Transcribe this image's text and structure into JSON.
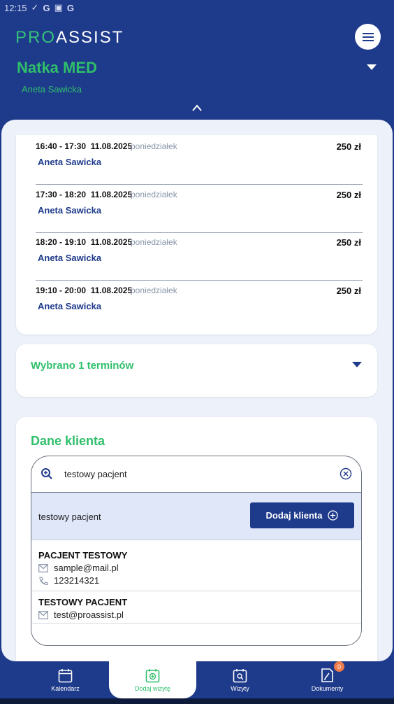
{
  "status_bar": {
    "time": "12:15",
    "icons": [
      "signal-icon",
      "google-icon",
      "photo-icon",
      "google-icon"
    ]
  },
  "header": {
    "logo_part1": "PRO",
    "logo_part2": "ASSIST",
    "clinic_name": "Natka MED",
    "doctor_name": "Aneta Sawicka"
  },
  "slots": [
    {
      "time": "16:40 - 17:30",
      "date": "11.08.2025",
      "day": "poniedziałek",
      "price": "250 zł",
      "person": "Aneta Sawicka"
    },
    {
      "time": "17:30 - 18:20",
      "date": "11.08.2025",
      "day": "poniedziałek",
      "price": "250 zł",
      "person": "Aneta Sawicka"
    },
    {
      "time": "18:20 - 19:10",
      "date": "11.08.2025",
      "day": "poniedziałek",
      "price": "250 zł",
      "person": "Aneta Sawicka"
    },
    {
      "time": "19:10 - 20:00",
      "date": "11.08.2025",
      "day": "poniedziałek",
      "price": "250 zł",
      "person": "Aneta Sawicka"
    }
  ],
  "selected_label": "Wybrano 1 terminów",
  "client": {
    "title": "Dane klienta",
    "search_value": "testowy pacjent",
    "new_query": "testowy pacjent",
    "add_button": "Dodaj klienta",
    "patients": [
      {
        "name": "PACJENT TESTOWY",
        "email": "sample@mail.pl",
        "phone": "123214321"
      },
      {
        "name": "TESTOWY PACJENT",
        "email": "test@proassist.pl"
      }
    ]
  },
  "nav": {
    "items": [
      {
        "label": "Kalendarz",
        "icon": "calendar-icon"
      },
      {
        "label": "Dodaj wizytę",
        "icon": "add-visit-icon"
      },
      {
        "label": "Wizyty",
        "icon": "visits-icon"
      },
      {
        "label": "Dokumenty",
        "icon": "documents-icon"
      }
    ],
    "badge_count": "0"
  },
  "colors": {
    "primary": "#1e3a8a",
    "accent": "#2fbf6b",
    "background": "#edf2fa",
    "badge": "#f07c4a"
  }
}
